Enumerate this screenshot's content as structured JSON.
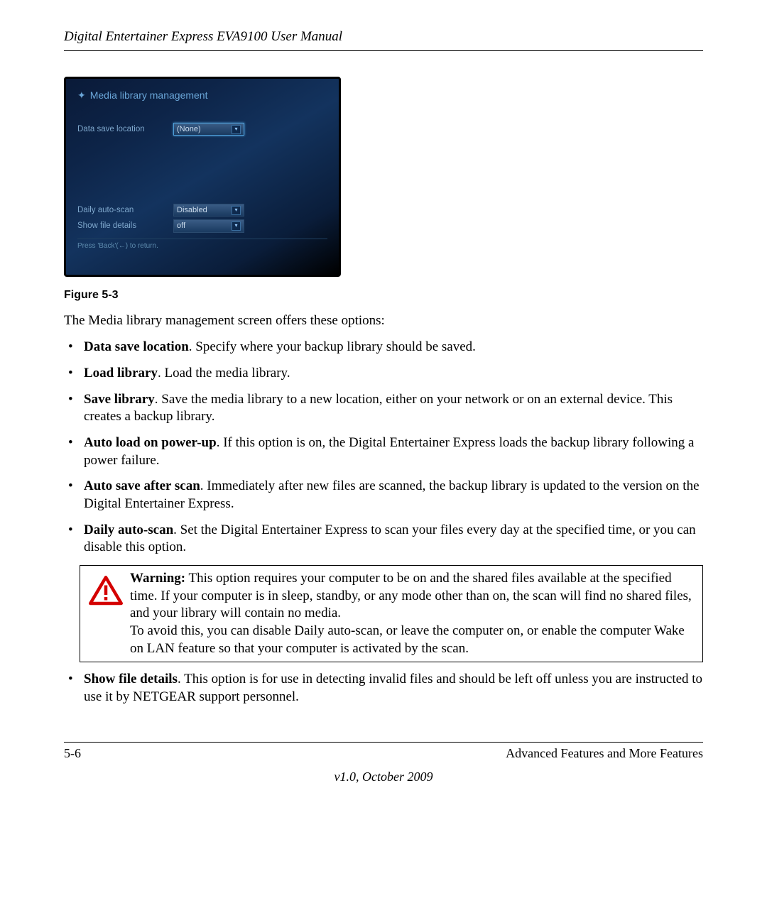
{
  "header": {
    "title": "Digital Entertainer Express EVA9100 User Manual"
  },
  "screenshot": {
    "title": "Media library management",
    "rows": {
      "data_save": {
        "label": "Data save location",
        "value": "(None)"
      },
      "daily_auto_scan": {
        "label": "Daily auto-scan",
        "value": "Disabled"
      },
      "show_file_details": {
        "label": "Show file details",
        "value": "off"
      }
    },
    "hint": "Press 'Back'(←) to return."
  },
  "figure_caption": "Figure 5-3",
  "intro": "The Media library management screen offers these options:",
  "bullets": {
    "data_save": {
      "term": "Data save location",
      "text": ". Specify where your backup library should be saved."
    },
    "load_library": {
      "term": "Load library",
      "text": ". Load the media library."
    },
    "save_library": {
      "term": "Save library",
      "text": ". Save the media library to a new location, either on your network or on an external device. This creates a backup library."
    },
    "auto_load": {
      "term": "Auto load on power-up",
      "text": ". If this option is on, the Digital Entertainer Express loads the backup library following a power failure."
    },
    "auto_save": {
      "term": "Auto save after scan",
      "text": ". Immediately after new files are scanned, the backup library is updated to the version on the Digital Entertainer Express."
    },
    "daily_auto_scan": {
      "term": "Daily auto-scan",
      "text": ". Set the Digital Entertainer Express to scan your files every day at the specified time, or you can disable this option."
    },
    "show_file_details": {
      "term": "Show file details",
      "text": ". This option is for use in detecting invalid files and should be left off unless you are instructed to use it by NETGEAR support personnel."
    }
  },
  "warning": {
    "label": "Warning:",
    "text1": " This option requires your computer to be on and the shared files available at the specified time. If your computer is in sleep, standby, or any mode other than on, the scan will find no shared files, and your library will contain no media.",
    "text2": "To avoid this, you can disable Daily auto-scan, or leave the computer on, or enable the computer Wake on LAN feature so that your computer is activated by the scan."
  },
  "footer": {
    "page": "5-6",
    "section": "Advanced Features and More Features",
    "version": "v1.0, October 2009"
  }
}
